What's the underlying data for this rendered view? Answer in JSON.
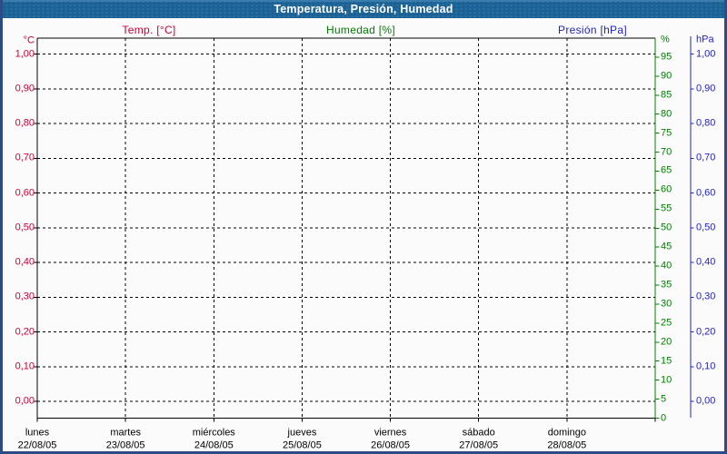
{
  "window": {
    "title": "Temperatura, Presión, Humedad"
  },
  "legend": {
    "temp": "Temp. [°C]",
    "humidity": "Humedad [%]",
    "pressure": "Presión [hPa]"
  },
  "colors": {
    "temp": "#cc0033",
    "humidity": "#008000",
    "pressure": "#2222cc",
    "grid": "#000000",
    "titlebar_bg": "#1b6296",
    "titlebar_text": "#ffffff",
    "frame_border": "#2c4c86",
    "background": "#fafbfa"
  },
  "chart_data": {
    "type": "line",
    "title": "Temperatura, Presión, Humedad",
    "grid": true,
    "x_days": [
      "lunes",
      "martes",
      "miércoles",
      "jueves",
      "viernes",
      "sábado",
      "domingo"
    ],
    "x_dates": [
      "22/08/05",
      "23/08/05",
      "24/08/05",
      "25/08/05",
      "26/08/05",
      "27/08/05",
      "28/08/05"
    ],
    "axes": {
      "temp": {
        "unit": "°C",
        "side": "left",
        "range": [
          0,
          1
        ],
        "ticks": [
          "1,00",
          "0,90",
          "0,80",
          "0,70",
          "0,60",
          "0,50",
          "0,40",
          "0,30",
          "0,20",
          "0,10",
          "0,00"
        ]
      },
      "humidity": {
        "unit": "%",
        "side": "right-inner",
        "range": [
          0,
          100
        ],
        "tick_step": 5,
        "ticks": [
          "95",
          "90",
          "85",
          "80",
          "75",
          "70",
          "65",
          "60",
          "55",
          "50",
          "45",
          "40",
          "35",
          "30",
          "25",
          "20",
          "15",
          "10",
          "5",
          "0"
        ]
      },
      "pressure": {
        "unit": "hPa",
        "side": "right-outer",
        "range": [
          0,
          1
        ],
        "ticks": [
          "1,00",
          "0,90",
          "0,80",
          "0,70",
          "0,60",
          "0,50",
          "0,40",
          "0,30",
          "0,20",
          "0,10",
          "0,00"
        ]
      }
    },
    "series": [
      {
        "name": "Temp. [°C]",
        "axis": "temp",
        "values": []
      },
      {
        "name": "Humedad [%]",
        "axis": "humidity",
        "values": []
      },
      {
        "name": "Presión [hPa]",
        "axis": "pressure",
        "values": []
      }
    ]
  }
}
